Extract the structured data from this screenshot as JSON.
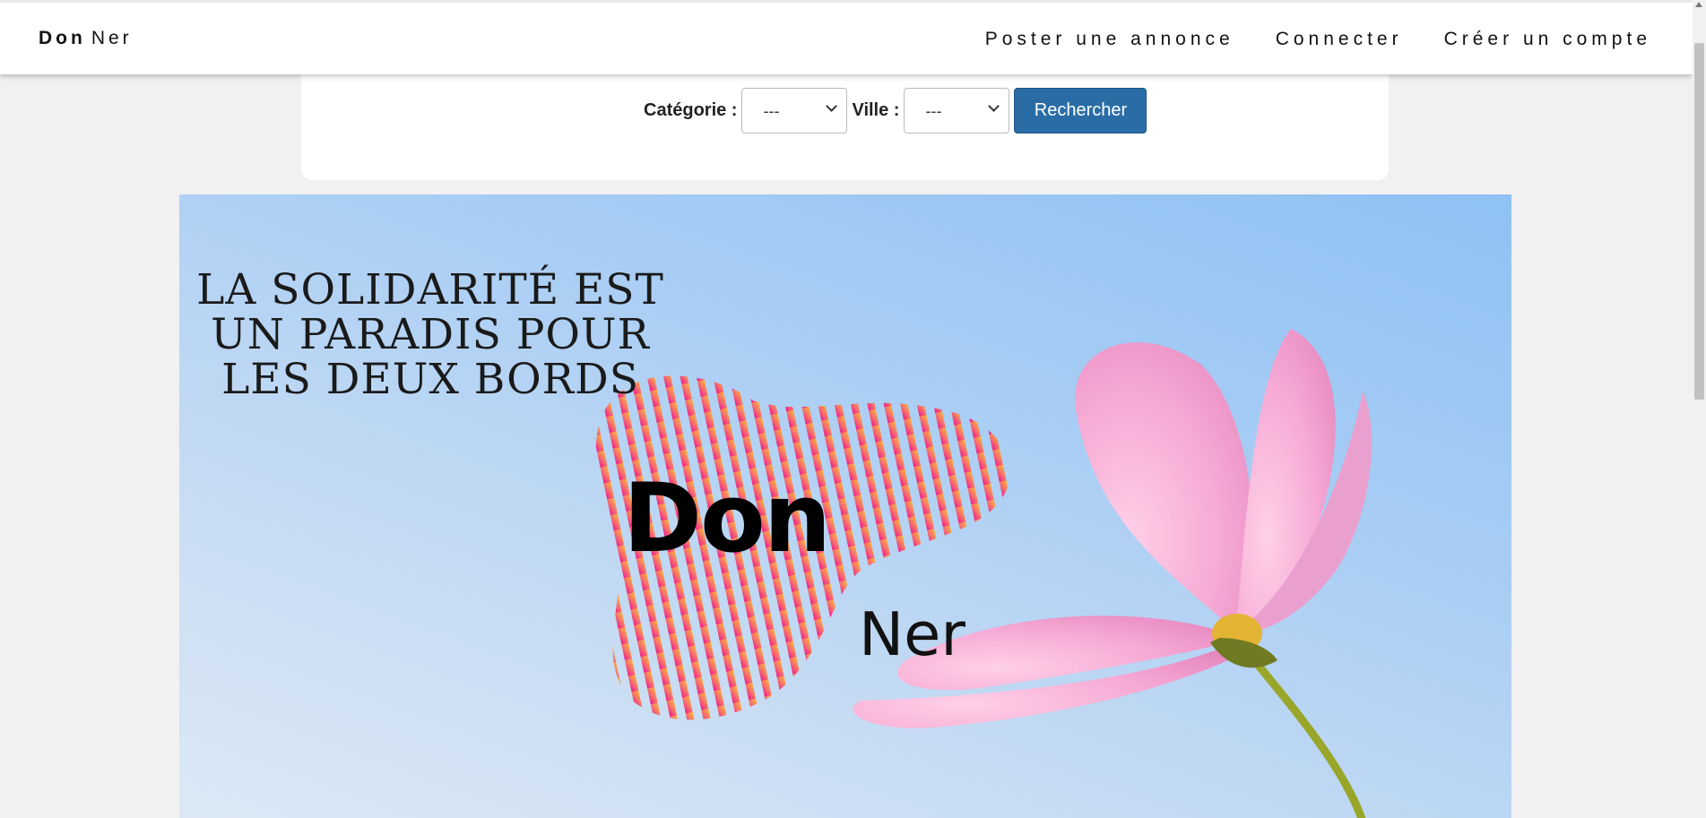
{
  "navbar": {
    "brand_bold": "Don",
    "brand_rest": "Ner",
    "links": [
      "Poster une annonce",
      "Connecter",
      "Créer un compte"
    ]
  },
  "search": {
    "category_label": "Catégorie :",
    "category_value": "---",
    "city_label": "Ville :",
    "city_value": "---",
    "submit_label": "Rechercher"
  },
  "hero": {
    "slogan_lines": [
      "LA SOLIDARITÉ EST",
      "UN PARADIS POUR",
      "LES DEUX BORDS"
    ],
    "logo_word_1": "Don",
    "logo_word_2": "Ner"
  },
  "colors": {
    "button": "#2a6da6",
    "sky": "#9fc8f3",
    "stripe_start": "#f2188f",
    "stripe_end": "#fbb43a",
    "petal": "#f0a0d0"
  }
}
